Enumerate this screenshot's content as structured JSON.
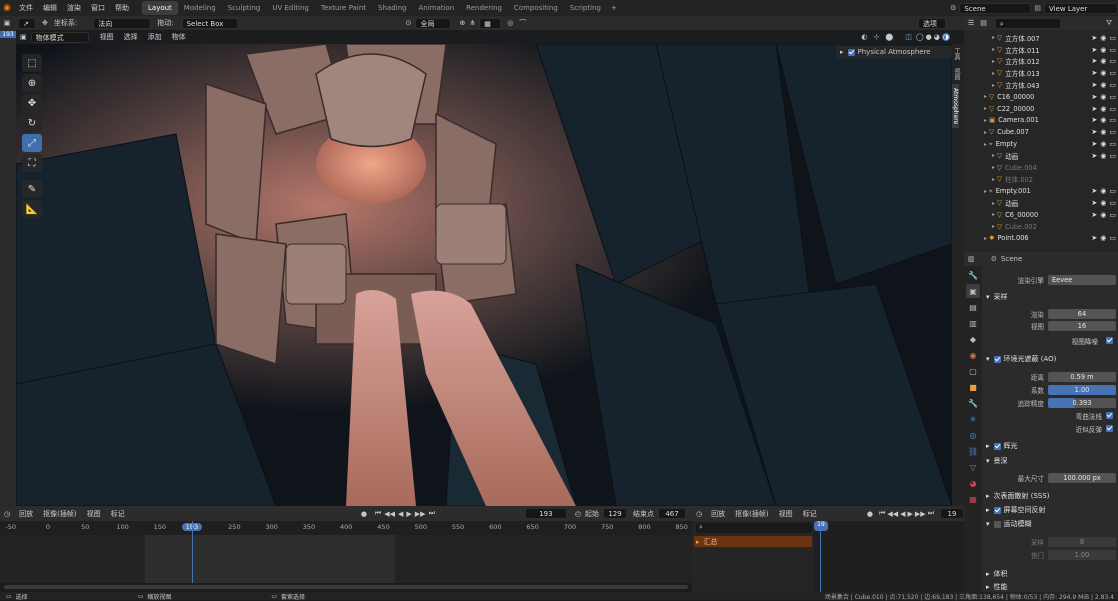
{
  "topbar": {
    "menus": [
      "文件",
      "编辑",
      "渲染",
      "窗口",
      "帮助"
    ],
    "workspaces": [
      "Layout",
      "Modeling",
      "Sculpting",
      "UV Editing",
      "Texture Paint",
      "Shading",
      "Animation",
      "Rendering",
      "Compositing",
      "Scripting"
    ],
    "active_workspace": "Layout",
    "scene": "Scene",
    "view_layer": "View Layer"
  },
  "viewport": {
    "transform_label": "坐标系:",
    "orientation": "法向",
    "drag_label": "拖动:",
    "drag_mode": "Select Box",
    "pivot": "全局",
    "options": "选项",
    "frame_badge": "193",
    "mode": "物体模式",
    "menus": [
      "视图",
      "选择",
      "添加",
      "物体"
    ],
    "right_tabs": [
      "工具",
      "视图",
      "Atmosphere"
    ],
    "atmo_panel_label": "Physical Atmosphere",
    "tools": [
      "select-tool",
      "cursor-tool",
      "move-tool",
      "rotate-tool",
      "scale-tool",
      "transform-tool",
      "annotate-tool",
      "measure-tool"
    ]
  },
  "timeline": {
    "menus": [
      "回放",
      "抠像(插帧)",
      "视图",
      "标记"
    ],
    "current_frame": "193",
    "start_label": "起始",
    "start": "129",
    "end_label": "结束点",
    "end": "467",
    "ticks": [
      "-50",
      "0",
      "50",
      "100",
      "150",
      "193",
      "250",
      "300",
      "350",
      "400",
      "450",
      "500",
      "550",
      "600",
      "650",
      "700",
      "750",
      "800",
      "850"
    ]
  },
  "dopesheet": {
    "menus": [
      "回放",
      "抠像(插帧)",
      "视图",
      "标记"
    ],
    "frame": "19",
    "summary": "汇总"
  },
  "outliner": {
    "rows": [
      {
        "name": "立方体.007",
        "dim": false,
        "indent": 2
      },
      {
        "name": "立方体.011",
        "dim": false,
        "indent": 2
      },
      {
        "name": "立方体.012",
        "dim": false,
        "indent": 2
      },
      {
        "name": "立方体.013",
        "dim": false,
        "indent": 2
      },
      {
        "name": "立方体.043",
        "dim": false,
        "indent": 2
      },
      {
        "name": "C16_00000",
        "dim": false,
        "indent": 1
      },
      {
        "name": "C22_00000",
        "dim": false,
        "indent": 1
      },
      {
        "name": "Camera.001",
        "dim": false,
        "indent": 1
      },
      {
        "name": "Cube.007",
        "dim": false,
        "indent": 1
      },
      {
        "name": "Empty",
        "dim": false,
        "indent": 1
      },
      {
        "name": "动画",
        "dim": false,
        "indent": 2
      },
      {
        "name": "Cube.004",
        "dim": true,
        "indent": 2
      },
      {
        "name": "柱体.002",
        "dim": true,
        "indent": 2
      },
      {
        "name": "Empty.001",
        "dim": false,
        "indent": 1
      },
      {
        "name": "动画",
        "dim": false,
        "indent": 2
      },
      {
        "name": "C6_00000",
        "dim": false,
        "indent": 2
      },
      {
        "name": "Cube.002",
        "dim": true,
        "indent": 2
      },
      {
        "name": "Point.006",
        "dim": false,
        "indent": 1
      }
    ]
  },
  "properties": {
    "scene_name": "Scene",
    "render_engine_label": "渲染引擎",
    "render_engine": "Eevee",
    "sampling": {
      "title": "采样",
      "render_label": "渲染",
      "render": "64",
      "viewport_label": "视图",
      "viewport": "16",
      "denoise_label": "视图降噪"
    },
    "ao": {
      "title": "环境光遮蔽 (AO)",
      "distance_label": "距离",
      "distance": "0.59 m",
      "factor_label": "系数",
      "factor": "1.00",
      "trace_label": "追踪精度",
      "trace": "0.393",
      "bent_label": "弯曲法线",
      "bounce_label": "近似反弹"
    },
    "bloom": "辉光",
    "dof": {
      "title": "景深",
      "max_label": "最大尺寸",
      "max": "100.000 px"
    },
    "sss": "次表面散射 (SSS)",
    "ssr": "屏幕空间反射",
    "motion_blur": {
      "title": "运动模糊",
      "position_label": "采样",
      "position": "8",
      "shutter_label": "快门",
      "shutter": "1.00"
    },
    "volumetric": "体积",
    "performance": "性能"
  },
  "status": {
    "left": "选择",
    "mid1": "缩放视图",
    "mid2": "套索选择",
    "right": "场景集合 | Cube.010 | 点:71,520 | 边:69,183 | 三角面:138,654 | 物体:0/53 | 内存: 294.9 MiB | 2.83.4"
  },
  "colors": {
    "accent": "#4772b3",
    "panel": "#2b2b2b",
    "orange": "#e8a03a",
    "green": "#6ab04c"
  }
}
